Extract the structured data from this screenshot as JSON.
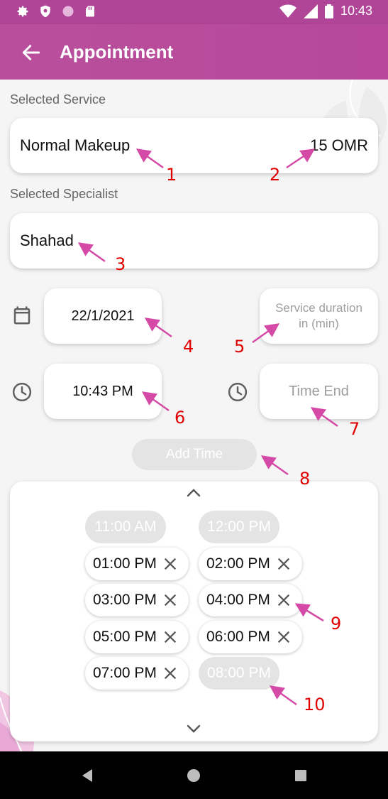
{
  "status_bar": {
    "time": "10:43",
    "left_icons": [
      "gear-icon",
      "shield-icon",
      "circle-icon",
      "sd-card-icon"
    ],
    "right_icons": [
      "wifi-icon",
      "signal-icon",
      "battery-icon"
    ]
  },
  "app_bar": {
    "title": "Appointment",
    "back_icon": "arrow-left-icon",
    "color": "#b84f9c"
  },
  "form": {
    "selected_service_label": "Selected Service",
    "service_name": "Normal Makeup",
    "service_price": "15 OMR",
    "selected_specialist_label": "Selected Specialist",
    "specialist_name": "Shahad",
    "date": "22/1/2021",
    "duration_placeholder": "Service duration in (min)",
    "time_start": "10:43 PM",
    "time_end_placeholder": "Time End",
    "add_time_label": "Add Time"
  },
  "time_slots": [
    {
      "time": "11:00 AM",
      "disabled": true
    },
    {
      "time": "12:00 PM",
      "disabled": true
    },
    {
      "time": "01:00 PM",
      "disabled": false
    },
    {
      "time": "02:00 PM",
      "disabled": false
    },
    {
      "time": "03:00 PM",
      "disabled": false
    },
    {
      "time": "04:00 PM",
      "disabled": false
    },
    {
      "time": "05:00 PM",
      "disabled": false
    },
    {
      "time": "06:00 PM",
      "disabled": false
    },
    {
      "time": "07:00 PM",
      "disabled": false
    },
    {
      "time": "08:00 PM",
      "disabled": true
    }
  ],
  "annotations": [
    "1",
    "2",
    "3",
    "4",
    "5",
    "6",
    "7",
    "8",
    "9",
    "10"
  ],
  "colors": {
    "accent": "#b04497",
    "annotation_arrow": "#d44aa6",
    "annotation_number": "#e00000",
    "disabled_chip": "#e4e4e4"
  }
}
